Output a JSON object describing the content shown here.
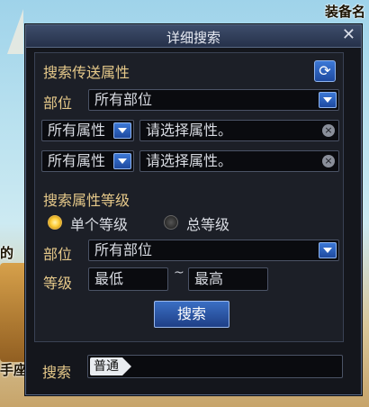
{
  "background": {
    "top_right_text": "装备名",
    "left_text_1": "的",
    "left_text_2": "手座"
  },
  "dialog": {
    "title": "详细搜索",
    "close_symbol": "✕"
  },
  "attributes": {
    "section_title": "搜索传送属性",
    "refresh_symbol": "⟳",
    "slot_label": "部位",
    "slot_value": "所有部位",
    "row1_select": "所有属性",
    "row1_placeholder": "请选择属性。",
    "row2_select": "所有属性",
    "row2_placeholder": "请选择属性。"
  },
  "level": {
    "section_title": "搜索属性等级",
    "radio_single": "单个等级",
    "radio_total": "总等级",
    "selected": "单个等级",
    "slot_label": "部位",
    "slot_value": "所有部位",
    "level_label": "等级",
    "min_placeholder": "最低",
    "tilde": "~",
    "max_placeholder": "最高"
  },
  "actions": {
    "search_button": "搜索"
  },
  "footer": {
    "search_label": "搜索",
    "mode": "普通"
  },
  "colors": {
    "accent_blue": "#2a5cb8",
    "label_gold": "#e6c98a",
    "panel_bg": "#1c1f27"
  }
}
